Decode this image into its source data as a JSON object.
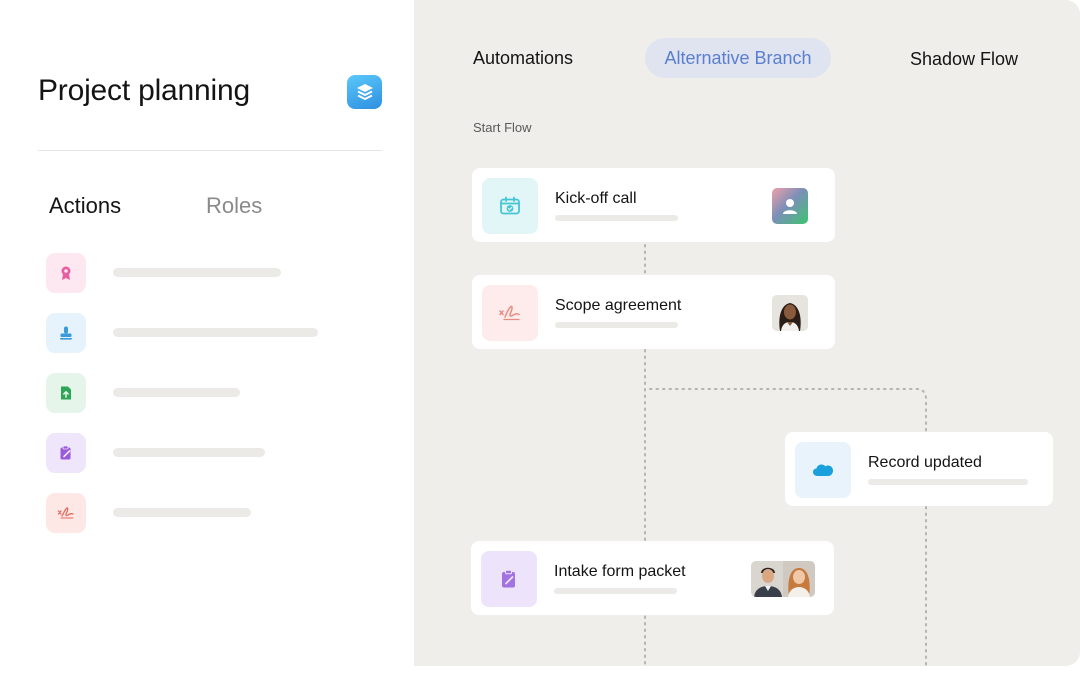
{
  "project": {
    "title": "Project planning",
    "icon": "stack-layers-icon",
    "icon_color": "#2f8fe0"
  },
  "left_tabs": {
    "actions": "Actions",
    "roles": "Roles"
  },
  "actions": [
    {
      "icon": "badge-award-icon",
      "tile_color": "#fde7f1",
      "icon_color": "#e85ea0"
    },
    {
      "icon": "stamp-icon",
      "tile_color": "#e6f3fc",
      "icon_color": "#3b9ad9"
    },
    {
      "icon": "file-upload-icon",
      "tile_color": "#e5f5ea",
      "icon_color": "#2fa557"
    },
    {
      "icon": "clipboard-edit-icon",
      "tile_color": "#efe6fb",
      "icon_color": "#9a5ad9"
    },
    {
      "icon": "signature-icon",
      "tile_color": "#fde8e6",
      "icon_color": "#e46a5e"
    }
  ],
  "flow_tabs": {
    "automations": "Automations",
    "alternative": "Alternative Branch",
    "shadow": "Shadow Flow"
  },
  "start_label": "Start Flow",
  "cards": {
    "kickoff": {
      "title": "Kick-off call",
      "icon": "calendar-check-icon",
      "avatar": "user-avatar-icon"
    },
    "scope": {
      "title": "Scope agreement",
      "icon": "signature-icon",
      "avatar": "person-photo"
    },
    "record": {
      "title": "Record updated",
      "icon": "salesforce-cloud-icon"
    },
    "intake": {
      "title": "Intake form packet",
      "icon": "clipboard-edit-icon",
      "avatar": "two-person-photo"
    }
  },
  "colors": {
    "panel_bg": "#efeeea",
    "active_tab_bg": "#dfe4f0",
    "active_tab_text": "#5b7fd0"
  }
}
